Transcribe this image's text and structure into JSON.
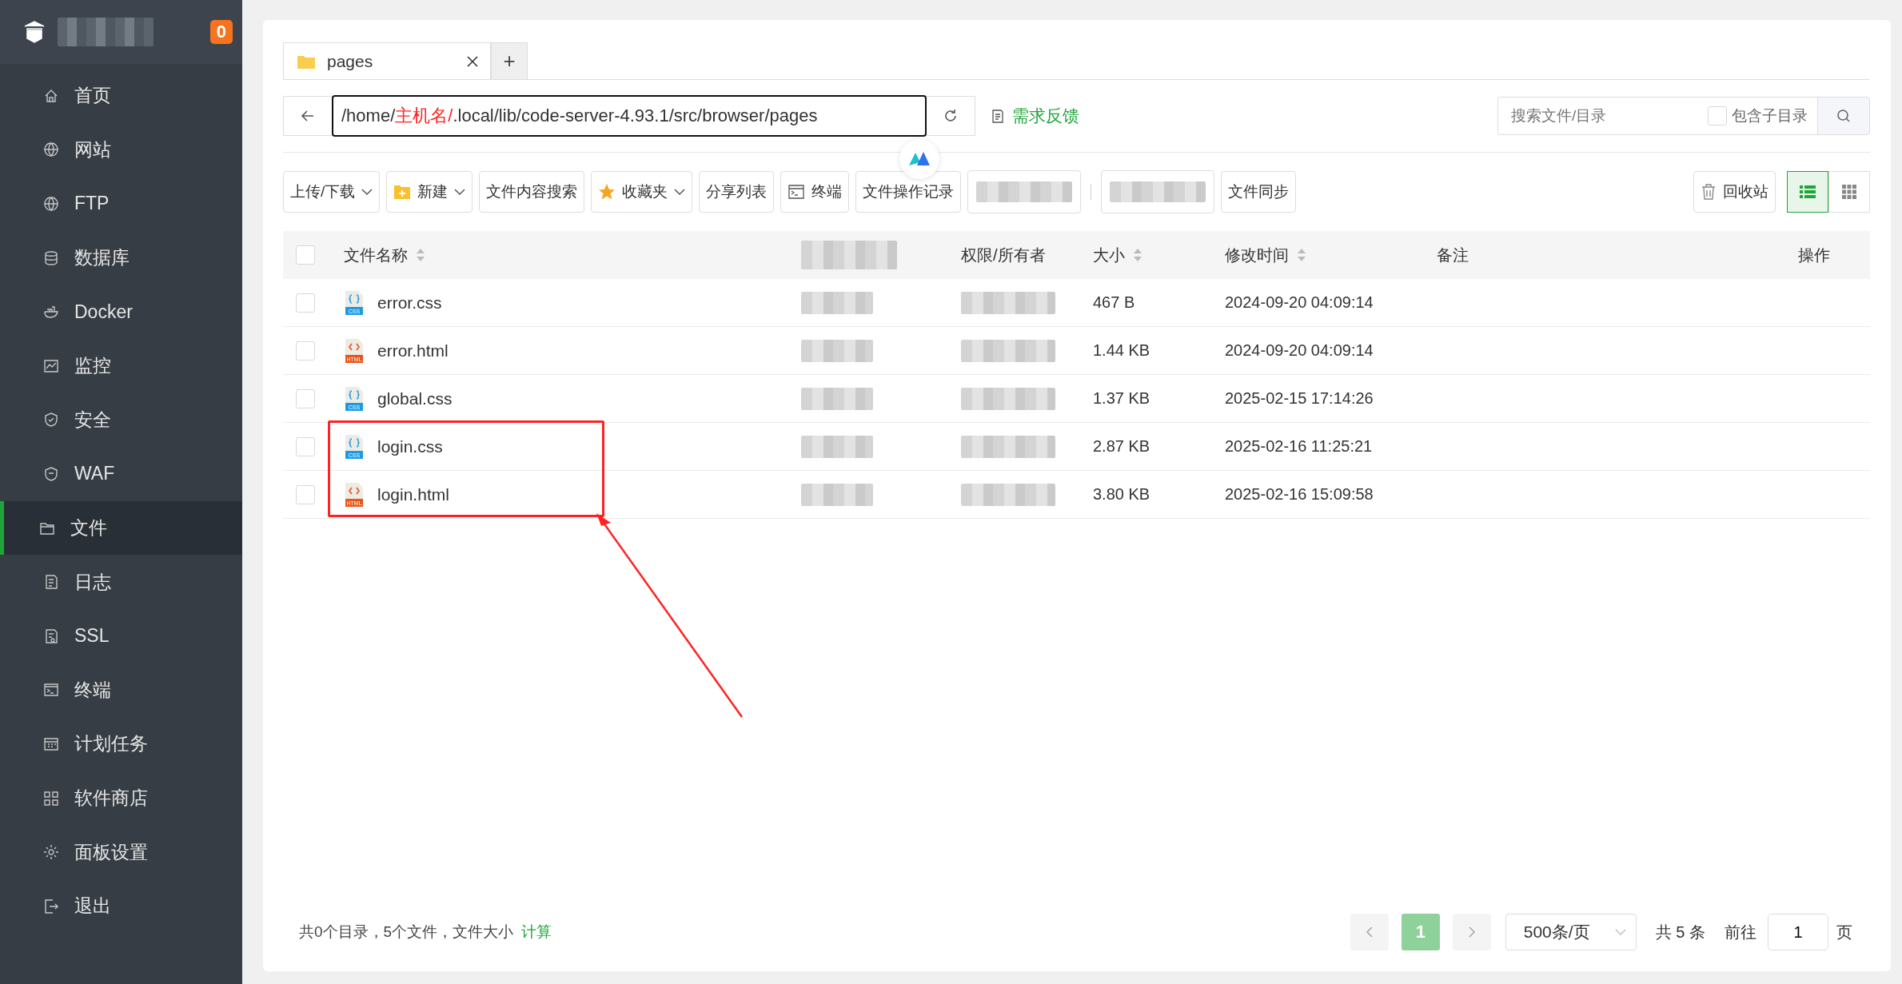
{
  "sidebar": {
    "badge": "0",
    "items": [
      {
        "label": "首页",
        "selected": false
      },
      {
        "label": "网站",
        "selected": false
      },
      {
        "label": "FTP",
        "selected": false
      },
      {
        "label": "数据库",
        "selected": false
      },
      {
        "label": "Docker",
        "selected": false
      },
      {
        "label": "监控",
        "selected": false
      },
      {
        "label": "安全",
        "selected": false
      },
      {
        "label": "WAF",
        "selected": false
      },
      {
        "label": "文件",
        "selected": true
      },
      {
        "label": "日志",
        "selected": false
      },
      {
        "label": "SSL",
        "selected": false
      },
      {
        "label": "终端",
        "selected": false
      },
      {
        "label": "计划任务",
        "selected": false
      },
      {
        "label": "软件商店",
        "selected": false
      },
      {
        "label": "面板设置",
        "selected": false
      },
      {
        "label": "退出",
        "selected": false
      }
    ]
  },
  "tabs": [
    {
      "label": "pages",
      "selected": true
    }
  ],
  "new_tab": "+",
  "path": {
    "parts": [
      {
        "text": "/home/",
        "kind": "plain"
      },
      {
        "text": "主机名/",
        "kind": "annotation"
      },
      {
        "text": ".local/lib/code-server-4.93.1/src/browser/pages",
        "kind": "plain"
      }
    ]
  },
  "feedback": "需求反馈",
  "search": {
    "placeholder": "搜索文件/目录",
    "subdir_label": "包含子目录",
    "subdir_checked": false
  },
  "toolbar": [
    {
      "kind": "dropdown",
      "label": "上传/下载"
    },
    {
      "kind": "new",
      "label": "新建"
    },
    {
      "kind": "plain",
      "label": "文件内容搜索"
    },
    {
      "kind": "favorites",
      "label": "收藏夹"
    },
    {
      "kind": "plain",
      "label": "分享列表"
    },
    {
      "kind": "terminal",
      "label": "终端"
    },
    {
      "kind": "plain",
      "label": "文件操作记录"
    },
    {
      "kind": "redacted"
    },
    {
      "kind": "separator"
    },
    {
      "kind": "redacted"
    },
    {
      "kind": "plain",
      "label": "文件同步"
    }
  ],
  "recycle": "回收站",
  "views": [
    {
      "kind": "list",
      "selected": true
    },
    {
      "kind": "grid",
      "selected": false
    }
  ],
  "table": {
    "all_checked": false,
    "columns": [
      {
        "kind": "name",
        "label": "文件名称",
        "sortable": true
      },
      {
        "kind": "redacted"
      },
      {
        "kind": "text",
        "label": "权限/所有者",
        "sortable": false
      },
      {
        "kind": "text",
        "label": "大小",
        "sortable": true
      },
      {
        "kind": "text",
        "label": "修改时间",
        "sortable": true
      },
      {
        "kind": "text",
        "label": "备注",
        "sortable": false
      },
      {
        "kind": "op",
        "label": "操作",
        "sortable": false
      }
    ],
    "rows": [
      {
        "name": "error.css",
        "kind": "css",
        "icon_label": "CSS",
        "size": "467 B",
        "modified": "2024-09-20 04:09:14",
        "checked": false
      },
      {
        "name": "error.html",
        "kind": "html",
        "icon_label": "HTML",
        "size": "1.44 KB",
        "modified": "2024-09-20 04:09:14",
        "checked": false
      },
      {
        "name": "global.css",
        "kind": "css",
        "icon_label": "CSS",
        "size": "1.37 KB",
        "modified": "2025-02-15 17:14:26",
        "checked": false
      },
      {
        "name": "login.css",
        "kind": "css",
        "icon_label": "CSS",
        "size": "2.87 KB",
        "modified": "2025-02-16 11:25:21",
        "checked": false
      },
      {
        "name": "login.html",
        "kind": "html",
        "icon_label": "HTML",
        "size": "3.80 KB",
        "modified": "2025-02-16 15:09:58",
        "checked": false
      }
    ]
  },
  "footer": {
    "summary": "共0个目录，5个文件，文件大小",
    "calc_link": "计算",
    "pages": [
      {
        "label": "1",
        "selected": true
      }
    ],
    "page_size": "500条/页",
    "total": "共 5 条",
    "goto_label": "前往",
    "goto_value": "1",
    "page_unit": "页"
  }
}
